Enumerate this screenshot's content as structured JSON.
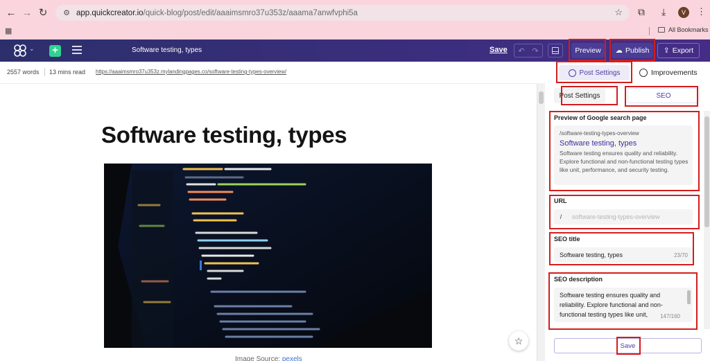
{
  "browser": {
    "url_host": "app.quickcreator.io",
    "url_path": "/quick-blog/post/edit/aaaimsmro37u353z/aaama7anwfvphi5a",
    "avatar_initial": "V",
    "bookmarks_label": "All Bookmarks"
  },
  "topbar": {
    "document_title": "Software testing, types",
    "save_label": "Save",
    "preview_label": "Preview",
    "publish_label": "Publish",
    "export_label": "Export",
    "accent_color": "#2fd38f"
  },
  "subbar": {
    "word_count": "2557 words",
    "read_time": "13 mins read",
    "published_url": "https://aaaimsmro37u353z.mylandingpages.co/software-testing-types-overview/",
    "post_settings_tab": "Post Settings",
    "improvements_tab": "Improvements"
  },
  "editor": {
    "post_title": "Software testing, types",
    "caption_prefix": "Image Source:",
    "caption_link": "pexels"
  },
  "panel": {
    "tabs": {
      "post_settings": "Post Settings",
      "seo": "SEO"
    },
    "google_preview": {
      "label": "Preview of Google search page",
      "url": "/software-testing-types-overview",
      "title": "Software testing, types",
      "description": "Software testing ensures quality and reliability. Explore functional and non-functional testing types like unit, performance, and security testing."
    },
    "url": {
      "label": "URL",
      "prefix": "/",
      "placeholder": "software-testing-types-overview"
    },
    "seo_title": {
      "label": "SEO title",
      "value": "Software testing, types",
      "count": "23/70"
    },
    "seo_description": {
      "label": "SEO description",
      "value": "Software testing ensures quality and reliability. Explore functional and non-functional testing types like unit,",
      "count": "147/160"
    },
    "save_label": "Save"
  }
}
